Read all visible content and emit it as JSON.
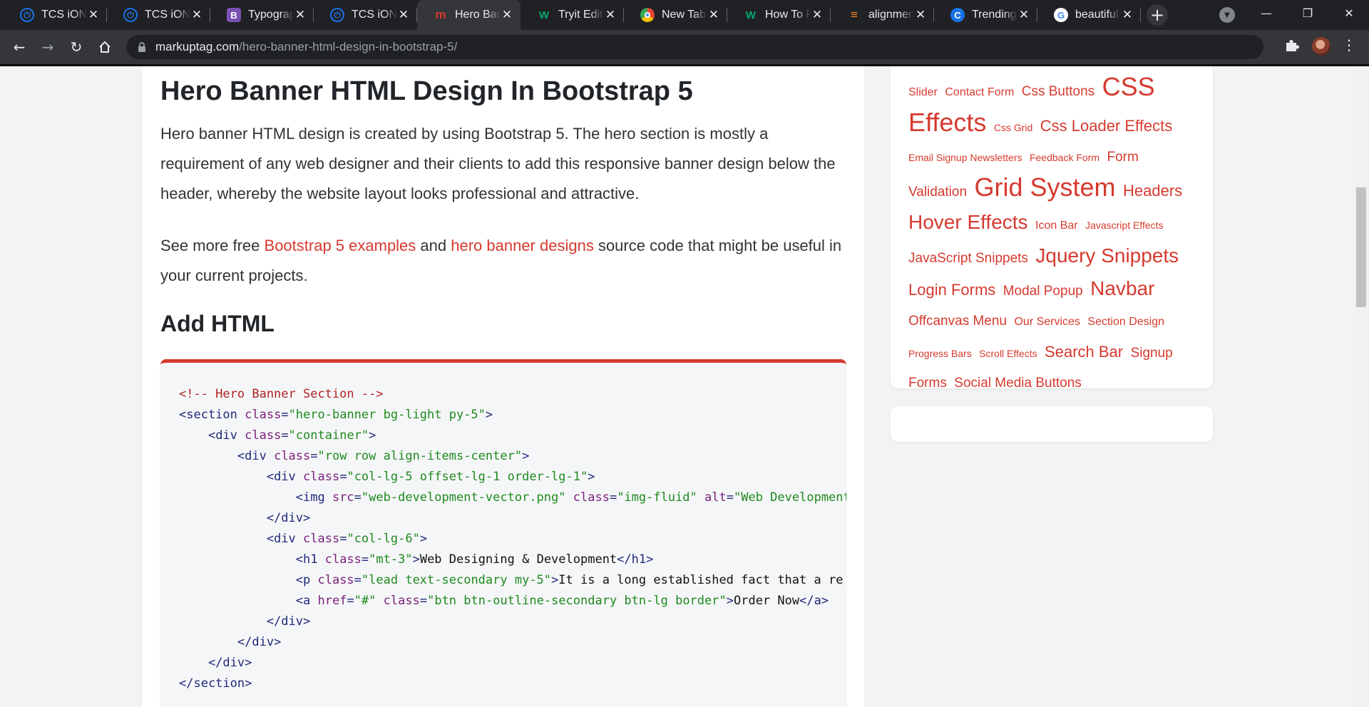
{
  "tabs": [
    {
      "title": "TCS iON D",
      "icon": "tcs-ion-icon",
      "color": "#1a73e8"
    },
    {
      "title": "TCS iON D",
      "icon": "tcs-ion-icon",
      "color": "#1a73e8"
    },
    {
      "title": "Typograph",
      "icon": "bootstrap-icon",
      "color": "#7952b3"
    },
    {
      "title": "TCS iON D",
      "icon": "tcs-ion-round-icon",
      "color": "#1a73e8"
    },
    {
      "title": "Hero Banne",
      "icon": "markuptag-icon",
      "color": "#d63a2f",
      "active": true
    },
    {
      "title": "Tryit Editor",
      "icon": "w3schools-icon",
      "color": "#04aa6d"
    },
    {
      "title": "New Tab",
      "icon": "chrome-icon",
      "color": "#e8eaed"
    },
    {
      "title": "How To P",
      "icon": "w3schools-icon",
      "color": "#04aa6d"
    },
    {
      "title": "alignment",
      "icon": "stackoverflow-icon",
      "color": "#f48024"
    },
    {
      "title": "Trending",
      "icon": "trending-icon",
      "color": "#1a73e8"
    },
    {
      "title": "beautiful",
      "icon": "google-icon",
      "color": "#4285f4"
    }
  ],
  "addressbar": {
    "host": "markuptag.com",
    "path": "/hero-banner-html-design-in-bootstrap-5/"
  },
  "article": {
    "title": "Hero Banner HTML Design In Bootstrap 5",
    "paragraph1": "Hero banner HTML design is created by using Bootstrap 5. The hero section is mostly a requirement of any web designer and their clients to add this responsive banner design below the header, whereby the website layout looks professional and attractive.",
    "paragraph2": {
      "before": "See more free ",
      "link1": "Bootstrap 5 examples",
      "middle": " and ",
      "link2": "hero banner designs",
      "after": " source code that might be useful in your current projects."
    },
    "section_heading": "Add HTML",
    "code_lines": [
      [
        {
          "c": "com",
          "t": "<!-- Hero Banner Section -->"
        }
      ],
      [
        {
          "c": "tag",
          "t": "<section "
        },
        {
          "c": "attr",
          "t": "class"
        },
        {
          "c": "tag",
          "t": "="
        },
        {
          "c": "val",
          "t": "\"hero-banner bg-light py-5\""
        },
        {
          "c": "tag",
          "t": ">"
        }
      ],
      [
        {
          "c": "txt",
          "t": "    "
        },
        {
          "c": "tag",
          "t": "<div "
        },
        {
          "c": "attr",
          "t": "class"
        },
        {
          "c": "tag",
          "t": "="
        },
        {
          "c": "val",
          "t": "\"container\""
        },
        {
          "c": "tag",
          "t": ">"
        }
      ],
      [
        {
          "c": "txt",
          "t": "        "
        },
        {
          "c": "tag",
          "t": "<div "
        },
        {
          "c": "attr",
          "t": "class"
        },
        {
          "c": "tag",
          "t": "="
        },
        {
          "c": "val",
          "t": "\"row row align-items-center\""
        },
        {
          "c": "tag",
          "t": ">"
        }
      ],
      [
        {
          "c": "txt",
          "t": "            "
        },
        {
          "c": "tag",
          "t": "<div "
        },
        {
          "c": "attr",
          "t": "class"
        },
        {
          "c": "tag",
          "t": "="
        },
        {
          "c": "val",
          "t": "\"col-lg-5 offset-lg-1 order-lg-1\""
        },
        {
          "c": "tag",
          "t": ">"
        }
      ],
      [
        {
          "c": "txt",
          "t": "                "
        },
        {
          "c": "tag",
          "t": "<img "
        },
        {
          "c": "attr",
          "t": "src"
        },
        {
          "c": "tag",
          "t": "="
        },
        {
          "c": "val",
          "t": "\"web-development-vector.png\""
        },
        {
          "c": "tag",
          "t": " "
        },
        {
          "c": "attr",
          "t": "class"
        },
        {
          "c": "tag",
          "t": "="
        },
        {
          "c": "val",
          "t": "\"img-fluid\""
        },
        {
          "c": "tag",
          "t": " "
        },
        {
          "c": "attr",
          "t": "alt"
        },
        {
          "c": "tag",
          "t": "="
        },
        {
          "c": "val",
          "t": "\"Web Development\""
        }
      ],
      [
        {
          "c": "txt",
          "t": "            "
        },
        {
          "c": "tag",
          "t": "</div>"
        }
      ],
      [
        {
          "c": "txt",
          "t": "            "
        },
        {
          "c": "tag",
          "t": "<div "
        },
        {
          "c": "attr",
          "t": "class"
        },
        {
          "c": "tag",
          "t": "="
        },
        {
          "c": "val",
          "t": "\"col-lg-6\""
        },
        {
          "c": "tag",
          "t": ">"
        }
      ],
      [
        {
          "c": "txt",
          "t": "                "
        },
        {
          "c": "tag",
          "t": "<h1 "
        },
        {
          "c": "attr",
          "t": "class"
        },
        {
          "c": "tag",
          "t": "="
        },
        {
          "c": "val",
          "t": "\"mt-3\""
        },
        {
          "c": "tag",
          "t": ">"
        },
        {
          "c": "txt",
          "t": "Web Designing & Development"
        },
        {
          "c": "tag",
          "t": "</h1>"
        }
      ],
      [
        {
          "c": "txt",
          "t": "                "
        },
        {
          "c": "tag",
          "t": "<p "
        },
        {
          "c": "attr",
          "t": "class"
        },
        {
          "c": "tag",
          "t": "="
        },
        {
          "c": "val",
          "t": "\"lead text-secondary my-5\""
        },
        {
          "c": "tag",
          "t": ">"
        },
        {
          "c": "txt",
          "t": "It is a long established fact that a re"
        }
      ],
      [
        {
          "c": "txt",
          "t": "                "
        },
        {
          "c": "tag",
          "t": "<a "
        },
        {
          "c": "attr",
          "t": "href"
        },
        {
          "c": "tag",
          "t": "="
        },
        {
          "c": "val",
          "t": "\"#\""
        },
        {
          "c": "tag",
          "t": " "
        },
        {
          "c": "attr",
          "t": "class"
        },
        {
          "c": "tag",
          "t": "="
        },
        {
          "c": "val",
          "t": "\"btn btn-outline-secondary btn-lg border\""
        },
        {
          "c": "tag",
          "t": ">"
        },
        {
          "c": "txt",
          "t": "Order Now"
        },
        {
          "c": "tag",
          "t": "</a>"
        }
      ],
      [
        {
          "c": "txt",
          "t": "            "
        },
        {
          "c": "tag",
          "t": "</div>"
        }
      ],
      [
        {
          "c": "txt",
          "t": "        "
        },
        {
          "c": "tag",
          "t": "</div>"
        }
      ],
      [
        {
          "c": "txt",
          "t": "    "
        },
        {
          "c": "tag",
          "t": "</div>"
        }
      ],
      [
        {
          "c": "tag",
          "t": "</section>"
        }
      ]
    ]
  },
  "tag_cloud": [
    {
      "label": "Slider",
      "size": 2
    },
    {
      "label": "Contact Form",
      "size": 2
    },
    {
      "label": "Css Buttons",
      "size": 3
    },
    {
      "label": "CSS Effects",
      "size": 6
    },
    {
      "label": "Css Grid",
      "size": 1
    },
    {
      "label": "Css Loader Effects",
      "size": 4
    },
    {
      "label": "Email Signup Newsletters",
      "size": 1
    },
    {
      "label": "Feedback Form",
      "size": 1
    },
    {
      "label": "Form Validation",
      "size": 3
    },
    {
      "label": "Grid System",
      "size": 6
    },
    {
      "label": "Headers",
      "size": 4
    },
    {
      "label": "Hover Effects",
      "size": 5
    },
    {
      "label": "Icon Bar",
      "size": 2
    },
    {
      "label": "Javascript Effects",
      "size": 1
    },
    {
      "label": "JavaScript Snippets",
      "size": 3
    },
    {
      "label": "Jquery Snippets",
      "size": 5
    },
    {
      "label": "Login Forms",
      "size": 4
    },
    {
      "label": "Modal Popup",
      "size": 3
    },
    {
      "label": "Navbar",
      "size": 5
    },
    {
      "label": "Offcanvas Menu",
      "size": 3
    },
    {
      "label": "Our Services",
      "size": 2
    },
    {
      "label": "Section Design",
      "size": 2
    },
    {
      "label": "Progress Bars",
      "size": 1
    },
    {
      "label": "Scroll Effects",
      "size": 1
    },
    {
      "label": "Search Bar",
      "size": 4
    },
    {
      "label": "Signup Forms",
      "size": 3
    },
    {
      "label": "Social Media Buttons",
      "size": 3
    }
  ],
  "colors": {
    "accent": "#d63a2f",
    "chrome_dark": "#202124",
    "chrome_toolbar": "#35363a"
  }
}
